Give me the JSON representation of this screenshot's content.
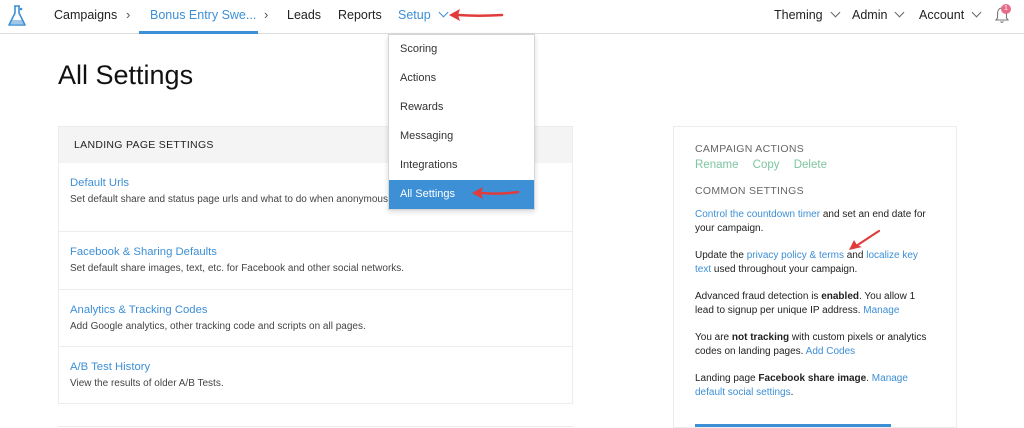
{
  "nav": {
    "campaigns": "Campaigns",
    "campaign_name": "Bonus Entry Swe...",
    "leads": "Leads",
    "reports": "Reports",
    "setup": "Setup",
    "theming": "Theming",
    "admin": "Admin",
    "account": "Account",
    "notification_count": "1"
  },
  "setup_menu": {
    "items": [
      "Scoring",
      "Actions",
      "Rewards",
      "Messaging",
      "Integrations",
      "All Settings"
    ],
    "selected": "All Settings"
  },
  "page": {
    "title": "All Settings"
  },
  "landing": {
    "header": "LANDING PAGE SETTINGS",
    "items": [
      {
        "title": "Default Urls",
        "desc": "Set default share and status page urls and what to do when anonymous users visit ur pages."
      },
      {
        "title": "Facebook & Sharing Defaults",
        "desc": "Set default share images, text, etc. for Facebook and other social networks."
      },
      {
        "title": "Analytics & Tracking Codes",
        "desc": "Add Google analytics, other tracking code and scripts on all pages."
      },
      {
        "title": "A/B Test History",
        "desc": "View the results of older A/B Tests."
      }
    ]
  },
  "side": {
    "campaign_actions": "CAMPAIGN ACTIONS",
    "rename": "Rename",
    "copy": "Copy",
    "delete": "Delete",
    "common_settings": "COMMON SETTINGS",
    "countdown_link": "Control the countdown timer",
    "countdown_text": " and set an end date for your campaign.",
    "update_prefix": "Update the ",
    "privacy_link": "privacy policy & terms",
    "and": " and ",
    "localize_link": "localize key text",
    "update_suffix": " used throughout your campaign.",
    "fraud_prefix": "Advanced fraud detection is ",
    "fraud_status": "enabled",
    "fraud_suffix": ". You allow 1 lead to signup per unique IP address. ",
    "manage": "Manage",
    "tracking_prefix": "You are ",
    "tracking_status": "not tracking",
    "tracking_suffix": " with custom pixels or analytics codes on landing pages. ",
    "add_codes": "Add Codes",
    "share_prefix": "Landing page ",
    "share_bold": "Facebook share image",
    "share_period": ". ",
    "share_link": "Manage default social settings",
    "share_end": "."
  },
  "colors": {
    "accent": "#3d8fd6",
    "green_link": "#7ec5a0",
    "arrow": "#e03c3c",
    "badge": "#e86b8a"
  }
}
